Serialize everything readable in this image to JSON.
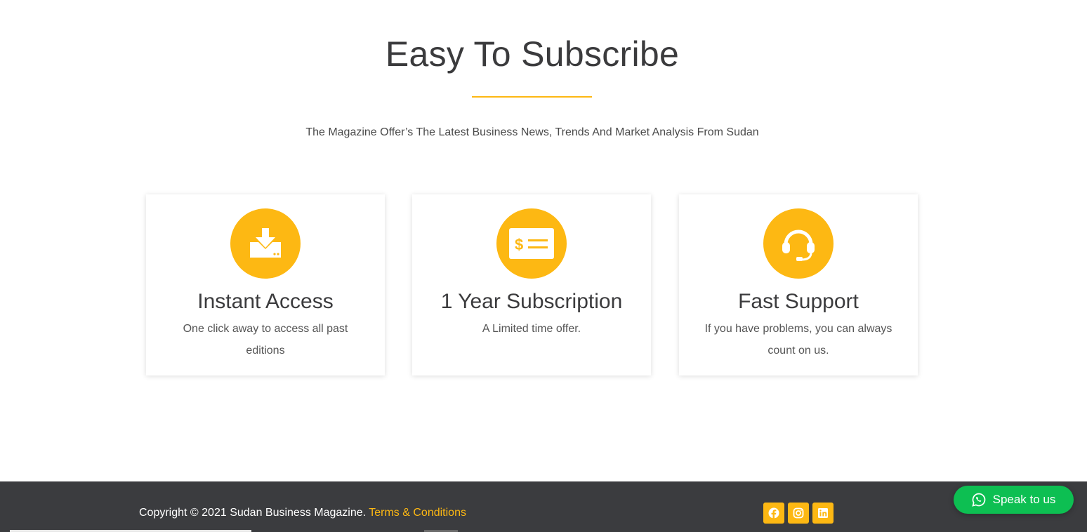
{
  "hero": {
    "title": "Easy To Subscribe",
    "subtitle": "The Magazine Offer’s The Latest Business News, Trends And Market Analysis From Sudan",
    "accent_color": "#fdb813"
  },
  "features": [
    {
      "icon": "download-icon",
      "title": "Instant Access",
      "text": "One click away to access all past editions"
    },
    {
      "icon": "payment-card-icon",
      "title": "1 Year Subscription",
      "text": "A Limited time offer."
    },
    {
      "icon": "headset-icon",
      "title": "Fast Support",
      "text": "If you have problems, you can always count on us."
    }
  ],
  "footer": {
    "copyright": "Copyright © 2021 Sudan Business Magazine.",
    "terms_label": "Terms & Conditions",
    "social": [
      "facebook-icon",
      "instagram-icon",
      "linkedin-icon"
    ],
    "background": "#3b3c3f"
  },
  "chat_button": {
    "label": "Speak to us",
    "icon": "whatsapp-icon",
    "color": "#0dbf52"
  }
}
